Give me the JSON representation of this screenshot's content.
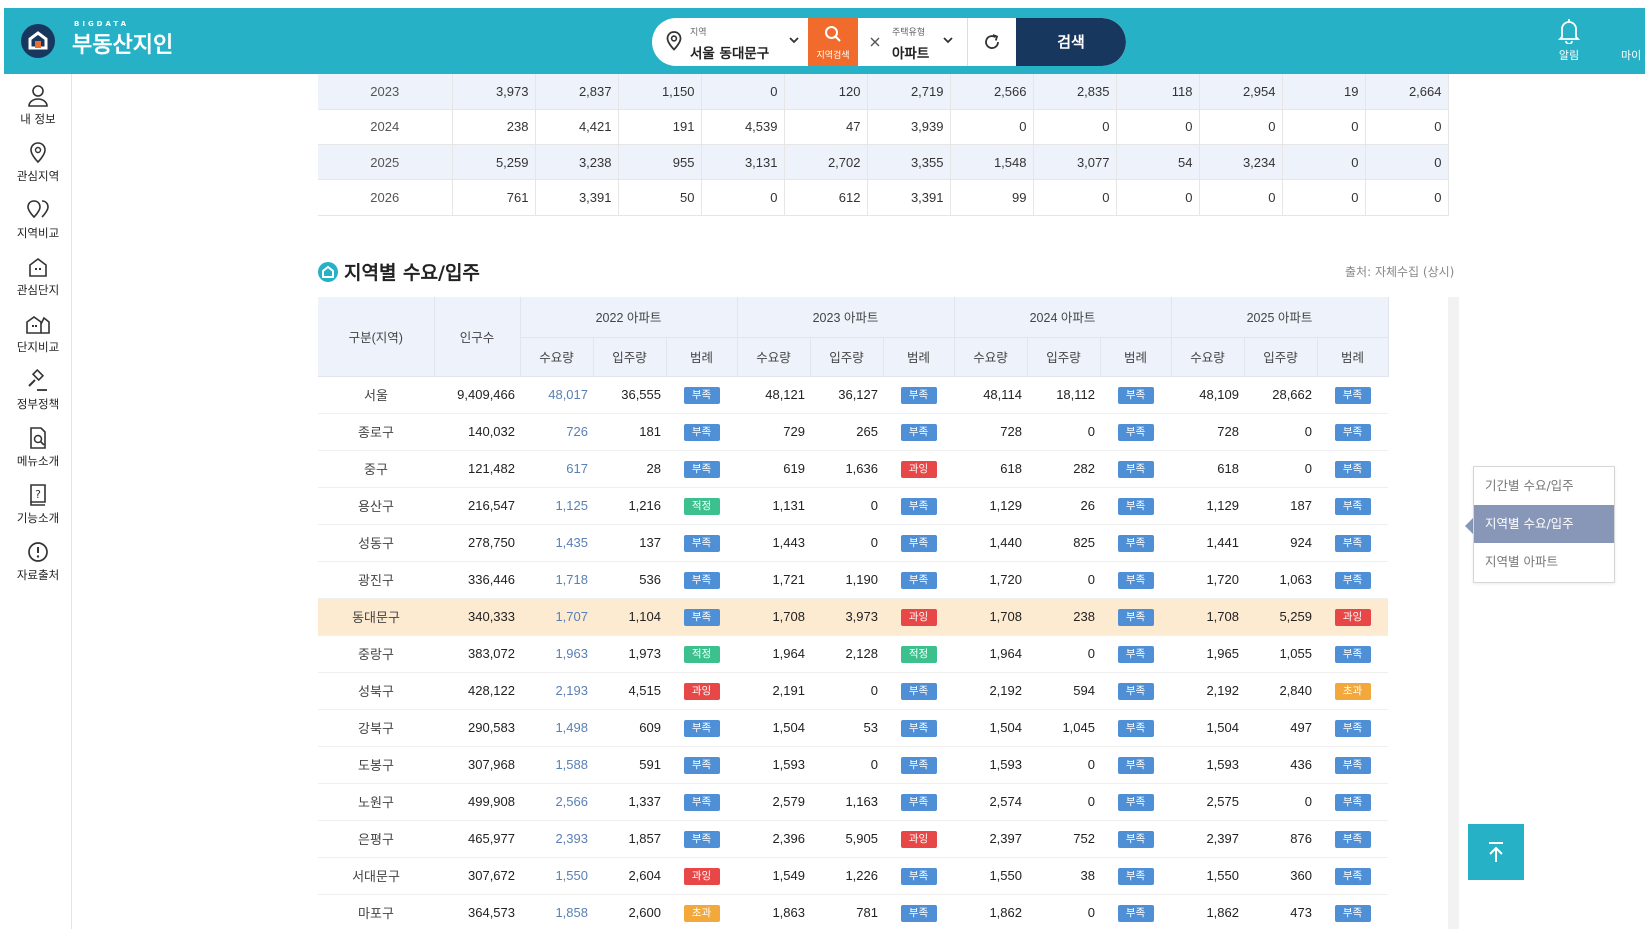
{
  "header": {
    "logo_small": "BIGDATA",
    "logo_big": "부동산지인",
    "region_label": "지역",
    "region_value": "서울 동대문구",
    "region_search_label": "지역검색",
    "type_label": "주택유형",
    "type_value": "아파트",
    "search_label": "검색",
    "alarm_label": "알림",
    "my_label": "마이"
  },
  "sidebar": {
    "items": [
      {
        "label": "내 정보"
      },
      {
        "label": "관심지역"
      },
      {
        "label": "지역비교"
      },
      {
        "label": "관심단지"
      },
      {
        "label": "단지비교"
      },
      {
        "label": "정부정책"
      },
      {
        "label": "메뉴소개"
      },
      {
        "label": "기능소개"
      },
      {
        "label": "자료출처"
      }
    ]
  },
  "top_table": {
    "rows": [
      [
        "2023",
        "3,973",
        "2,837",
        "1,150",
        "0",
        "120",
        "2,719",
        "2,566",
        "2,835",
        "118",
        "2,954",
        "19",
        "2,664"
      ],
      [
        "2024",
        "238",
        "4,421",
        "191",
        "4,539",
        "47",
        "3,939",
        "0",
        "0",
        "0",
        "0",
        "0",
        "0"
      ],
      [
        "2025",
        "5,259",
        "3,238",
        "955",
        "3,131",
        "2,702",
        "3,355",
        "1,548",
        "3,077",
        "54",
        "3,234",
        "0",
        "0"
      ],
      [
        "2026",
        "761",
        "3,391",
        "50",
        "0",
        "612",
        "3,391",
        "99",
        "0",
        "0",
        "0",
        "0",
        "0"
      ]
    ]
  },
  "section": {
    "title": "지역별 수요/입주",
    "source": "출처: 자체수집 (상시)"
  },
  "demand_table": {
    "col_region": "구분(지역)",
    "col_population": "인구수",
    "year_groups": [
      "2022 아파트",
      "2023 아파트",
      "2024 아파트",
      "2025 아파트"
    ],
    "sub_cols": [
      "수요량",
      "입주량",
      "범례"
    ],
    "legend": {
      "short": "부족",
      "over": "과잉",
      "ok": "적정",
      "exceed": "초과"
    },
    "rows": [
      {
        "name": "서울",
        "pop": "9,409,466",
        "y": [
          [
            "48,017",
            "36,555",
            "short"
          ],
          [
            "48,121",
            "36,127",
            "short"
          ],
          [
            "48,114",
            "18,112",
            "short"
          ],
          [
            "48,109",
            "28,662",
            "short"
          ]
        ]
      },
      {
        "name": "종로구",
        "pop": "140,032",
        "y": [
          [
            "726",
            "181",
            "short"
          ],
          [
            "729",
            "265",
            "short"
          ],
          [
            "728",
            "0",
            "short"
          ],
          [
            "728",
            "0",
            "short"
          ]
        ]
      },
      {
        "name": "중구",
        "pop": "121,482",
        "y": [
          [
            "617",
            "28",
            "short"
          ],
          [
            "619",
            "1,636",
            "over"
          ],
          [
            "618",
            "282",
            "short"
          ],
          [
            "618",
            "0",
            "short"
          ]
        ]
      },
      {
        "name": "용산구",
        "pop": "216,547",
        "y": [
          [
            "1,125",
            "1,216",
            "ok"
          ],
          [
            "1,131",
            "0",
            "short"
          ],
          [
            "1,129",
            "26",
            "short"
          ],
          [
            "1,129",
            "187",
            "short"
          ]
        ]
      },
      {
        "name": "성동구",
        "pop": "278,750",
        "y": [
          [
            "1,435",
            "137",
            "short"
          ],
          [
            "1,443",
            "0",
            "short"
          ],
          [
            "1,440",
            "825",
            "short"
          ],
          [
            "1,441",
            "924",
            "short"
          ]
        ]
      },
      {
        "name": "광진구",
        "pop": "336,446",
        "y": [
          [
            "1,718",
            "536",
            "short"
          ],
          [
            "1,721",
            "1,190",
            "short"
          ],
          [
            "1,720",
            "0",
            "short"
          ],
          [
            "1,720",
            "1,063",
            "short"
          ]
        ]
      },
      {
        "name": "동대문구",
        "pop": "340,333",
        "hl": true,
        "y": [
          [
            "1,707",
            "1,104",
            "short"
          ],
          [
            "1,708",
            "3,973",
            "over"
          ],
          [
            "1,708",
            "238",
            "short"
          ],
          [
            "1,708",
            "5,259",
            "over"
          ]
        ]
      },
      {
        "name": "중랑구",
        "pop": "383,072",
        "y": [
          [
            "1,963",
            "1,973",
            "ok"
          ],
          [
            "1,964",
            "2,128",
            "ok"
          ],
          [
            "1,964",
            "0",
            "short"
          ],
          [
            "1,965",
            "1,055",
            "short"
          ]
        ]
      },
      {
        "name": "성북구",
        "pop": "428,122",
        "y": [
          [
            "2,193",
            "4,515",
            "over"
          ],
          [
            "2,191",
            "0",
            "short"
          ],
          [
            "2,192",
            "594",
            "short"
          ],
          [
            "2,192",
            "2,840",
            "exceed"
          ]
        ]
      },
      {
        "name": "강북구",
        "pop": "290,583",
        "y": [
          [
            "1,498",
            "609",
            "short"
          ],
          [
            "1,504",
            "53",
            "short"
          ],
          [
            "1,504",
            "1,045",
            "short"
          ],
          [
            "1,504",
            "497",
            "short"
          ]
        ]
      },
      {
        "name": "도봉구",
        "pop": "307,968",
        "y": [
          [
            "1,588",
            "591",
            "short"
          ],
          [
            "1,593",
            "0",
            "short"
          ],
          [
            "1,593",
            "0",
            "short"
          ],
          [
            "1,593",
            "436",
            "short"
          ]
        ]
      },
      {
        "name": "노원구",
        "pop": "499,908",
        "y": [
          [
            "2,566",
            "1,337",
            "short"
          ],
          [
            "2,579",
            "1,163",
            "short"
          ],
          [
            "2,574",
            "0",
            "short"
          ],
          [
            "2,575",
            "0",
            "short"
          ]
        ]
      },
      {
        "name": "은평구",
        "pop": "465,977",
        "y": [
          [
            "2,393",
            "1,857",
            "short"
          ],
          [
            "2,396",
            "5,905",
            "over"
          ],
          [
            "2,397",
            "752",
            "short"
          ],
          [
            "2,397",
            "876",
            "short"
          ]
        ]
      },
      {
        "name": "서대문구",
        "pop": "307,672",
        "y": [
          [
            "1,550",
            "2,604",
            "over"
          ],
          [
            "1,549",
            "1,226",
            "short"
          ],
          [
            "1,550",
            "38",
            "short"
          ],
          [
            "1,550",
            "360",
            "short"
          ]
        ]
      },
      {
        "name": "마포구",
        "pop": "364,573",
        "y": [
          [
            "1,858",
            "2,600",
            "exceed"
          ],
          [
            "1,863",
            "781",
            "short"
          ],
          [
            "1,862",
            "0",
            "short"
          ],
          [
            "1,862",
            "473",
            "short"
          ]
        ]
      }
    ]
  },
  "float_menu": {
    "items": [
      "기간별 수요/입주",
      "지역별 수요/입주",
      "지역별 아파트"
    ],
    "active": 1
  },
  "colors": {
    "brand": "#26b1c6",
    "navy": "#17375e",
    "orange": "#f16c2c",
    "highlight_row": "#fdebd1"
  }
}
